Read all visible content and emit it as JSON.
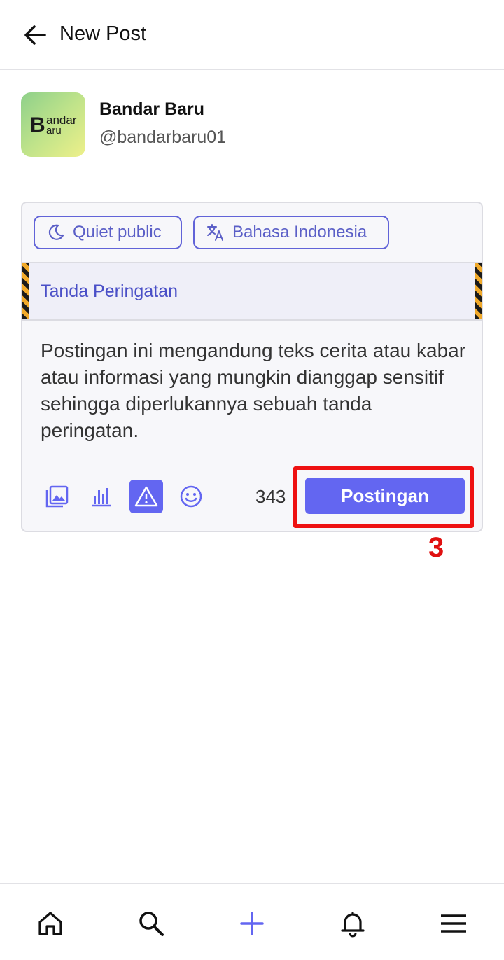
{
  "header": {
    "title": "New Post",
    "back_icon": "arrow-left-icon"
  },
  "user": {
    "name": "Bandar Baru",
    "handle": "@bandarbaru01",
    "avatar": {
      "big": "B",
      "line1": "andar",
      "line2": "aru"
    }
  },
  "composer": {
    "visibility": {
      "label": "Quiet public",
      "icon": "moon-icon"
    },
    "language": {
      "label": "Bahasa Indonesia",
      "icon": "translate-icon"
    },
    "content_warning": "Tanda Peringatan",
    "text": "Postingan ini mengandung teks cerita atau kabar atau informasi yang mungkin dianggap sensitif sehingga diperlukannya sebuah tanda peringatan.",
    "char_count": "343",
    "submit_label": "Postingan",
    "tools": [
      "image-icon",
      "poll-icon",
      "warning-icon",
      "emoji-icon"
    ],
    "active_tool": "warning-icon"
  },
  "annotation": {
    "step": "3",
    "color": "#ee1111"
  },
  "colors": {
    "accent": "#6366f1",
    "accent_text": "#5b5fc7"
  },
  "bottom_nav": [
    "home-icon",
    "search-icon",
    "plus-icon",
    "bell-icon",
    "menu-icon"
  ]
}
